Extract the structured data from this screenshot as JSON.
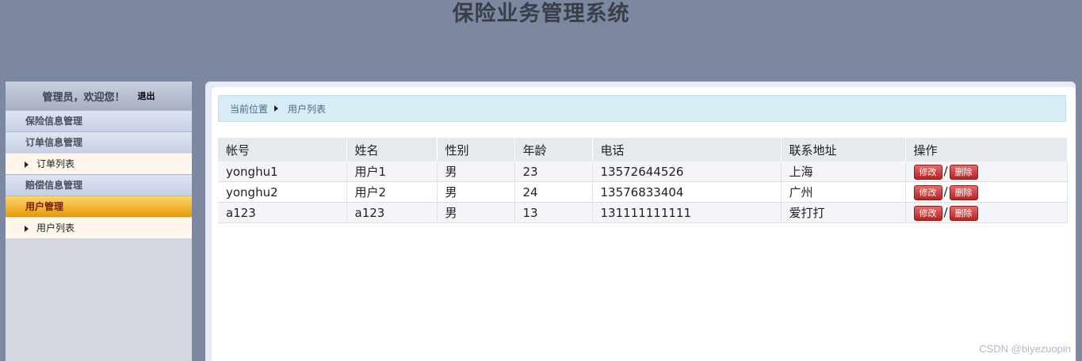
{
  "header": {
    "title": "保险业务管理系统"
  },
  "sidebar": {
    "welcome": "管理员，欢迎您！",
    "logout": "退出",
    "items": [
      {
        "label": "保险信息管理",
        "type": "group"
      },
      {
        "label": "订单信息管理",
        "type": "group"
      },
      {
        "label": "订单列表",
        "type": "sub"
      },
      {
        "label": "赔偿信息管理",
        "type": "group"
      },
      {
        "label": "用户管理",
        "type": "group-active"
      },
      {
        "label": "用户列表",
        "type": "sub"
      }
    ]
  },
  "breadcrumb": {
    "prefix": "当前位置",
    "current": "用户列表"
  },
  "table": {
    "columns": [
      "帐号",
      "姓名",
      "性别",
      "年龄",
      "电话",
      "联系地址",
      "操作"
    ],
    "rows": [
      {
        "account": "yonghu1",
        "name": "用户1",
        "gender": "男",
        "age": "23",
        "phone": "13572644526",
        "address": "上海"
      },
      {
        "account": "yonghu2",
        "name": "用户2",
        "gender": "男",
        "age": "24",
        "phone": "13576833404",
        "address": "广州"
      },
      {
        "account": "a123",
        "name": "a123",
        "gender": "男",
        "age": "13",
        "phone": "131111111111",
        "address": "爱打打"
      }
    ],
    "edit_label": "修改",
    "delete_label": "删除",
    "separator": "/"
  },
  "watermark": "CSDN @biyezuopin",
  "colors": {
    "header_bg": "#7b889f",
    "active_menu": "#e79a05",
    "delete_button": "#b42424"
  }
}
